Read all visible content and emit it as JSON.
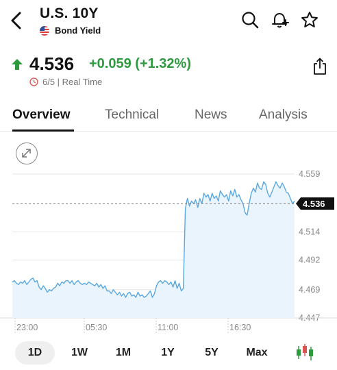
{
  "header": {
    "title": "U.S. 10Y",
    "subtitle": "Bond Yield"
  },
  "quote": {
    "price": "4.536",
    "change": "+0.059 (+1.32%)",
    "time": "6/5 | Real Time"
  },
  "tabs": [
    {
      "label": "Overview",
      "active": true
    },
    {
      "label": "Technical",
      "active": false
    },
    {
      "label": "News",
      "active": false
    },
    {
      "label": "Analysis",
      "active": false
    }
  ],
  "ranges": [
    {
      "label": "1D",
      "active": true
    },
    {
      "label": "1W",
      "active": false
    },
    {
      "label": "1M",
      "active": false
    },
    {
      "label": "1Y",
      "active": false
    },
    {
      "label": "5Y",
      "active": false
    },
    {
      "label": "Max",
      "active": false
    }
  ],
  "colors": {
    "positive": "#2e9a3e",
    "line": "#5aa8e0",
    "area": "#eaf4fc",
    "grid": "#e6e6e6"
  },
  "chart_data": {
    "type": "line",
    "series": [
      {
        "values": [
          4.475,
          4.476,
          4.474,
          4.473,
          4.475,
          4.474,
          4.476,
          4.473,
          4.475,
          4.477,
          4.478,
          4.475,
          4.476,
          4.471,
          4.469,
          4.472,
          4.47,
          4.467,
          4.469,
          4.468,
          4.47,
          4.471,
          4.474,
          4.472,
          4.475,
          4.474,
          4.476,
          4.476,
          4.474,
          4.476,
          4.473,
          4.475,
          4.476,
          4.474,
          4.473,
          4.474,
          4.473,
          4.475,
          4.474,
          4.473,
          4.472,
          4.474,
          4.471,
          4.473,
          4.47,
          4.472,
          4.468,
          4.468,
          4.466,
          4.469,
          4.467,
          4.465,
          4.467,
          4.464,
          4.466,
          4.463,
          4.466,
          4.467,
          4.464,
          4.465,
          4.463,
          4.467,
          4.464,
          4.465,
          4.463,
          4.464,
          4.466,
          4.468,
          4.463,
          4.466,
          4.472,
          4.475,
          4.476,
          4.474,
          4.476,
          4.475,
          4.473,
          4.475,
          4.471,
          4.476,
          4.47,
          4.474,
          4.468,
          4.47,
          4.532,
          4.54,
          4.534,
          4.538,
          4.536,
          4.539,
          4.533,
          4.54,
          4.536,
          4.544,
          4.541,
          4.543,
          4.538,
          4.544,
          4.54,
          4.542,
          4.538,
          4.546,
          4.543,
          4.541,
          4.543,
          4.538,
          4.546,
          4.542,
          4.547,
          4.541,
          4.543,
          4.539,
          4.536,
          4.529,
          4.527,
          4.536,
          4.544,
          4.548,
          4.545,
          4.552,
          4.548,
          4.547,
          4.553,
          4.551,
          4.544,
          4.541,
          4.545,
          4.549,
          4.553,
          4.55,
          4.548,
          4.552,
          4.549,
          4.545,
          4.544,
          4.54,
          4.536,
          4.538
        ]
      }
    ],
    "x_ticks": [
      "23:00",
      "05:30",
      "11:00",
      "16:30"
    ],
    "y_ticks": [
      4.559,
      4.514,
      4.492,
      4.469,
      4.447
    ],
    "ylim": [
      4.447,
      4.559
    ],
    "current": 4.536,
    "current_label": "4.536"
  }
}
